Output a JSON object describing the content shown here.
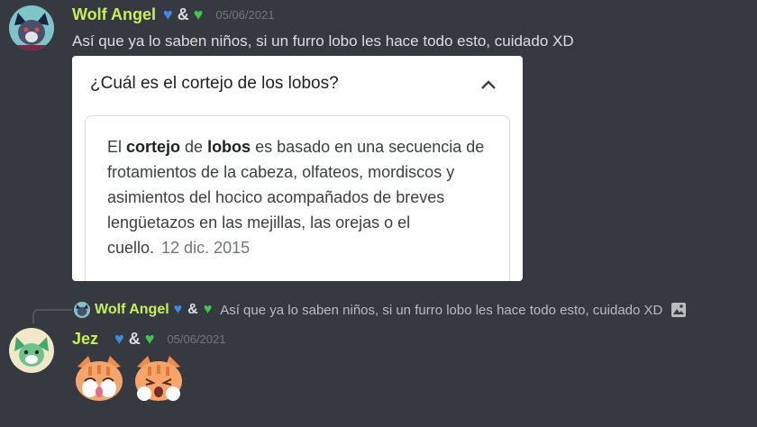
{
  "message1": {
    "username": "Wolf Angel",
    "amp": "&",
    "timestamp": "05/06/2021",
    "text": "Así que ya lo saben niños, si un furro lobo les hace todo esto, cuidado XD",
    "card": {
      "question": "¿Cuál es el cortejo de los lobos?",
      "answer_t1": "El ",
      "answer_b1": "cortejo",
      "answer_t2": " de ",
      "answer_b2": "lobos",
      "answer_t3": " es basado en una secuencia de frotamientos de la cabeza, olfateos, mordiscos y asimientos del hocico acompañados de breves lengüetazos en las mejillas, las orejas o el cuello.",
      "date": "12 dic. 2015"
    }
  },
  "reply": {
    "username": "Wolf Angel",
    "amp": "&",
    "text": "Así que ya lo saben niños, si un furro lobo les hace todo esto, cuidado XD"
  },
  "message2": {
    "username": "Jez",
    "amp": "&",
    "timestamp": "05/06/2021"
  },
  "colors": {
    "background": "#36393f",
    "username": "#c4f15a",
    "heart_blue": "#3c8ce6",
    "heart_green": "#3cc84a",
    "timestamp": "#72767d"
  },
  "icons": [
    "wolf-avatar",
    "heart-blue-icon",
    "heart-green-icon",
    "chevron-up-icon",
    "image-icon",
    "cat-sticker"
  ]
}
